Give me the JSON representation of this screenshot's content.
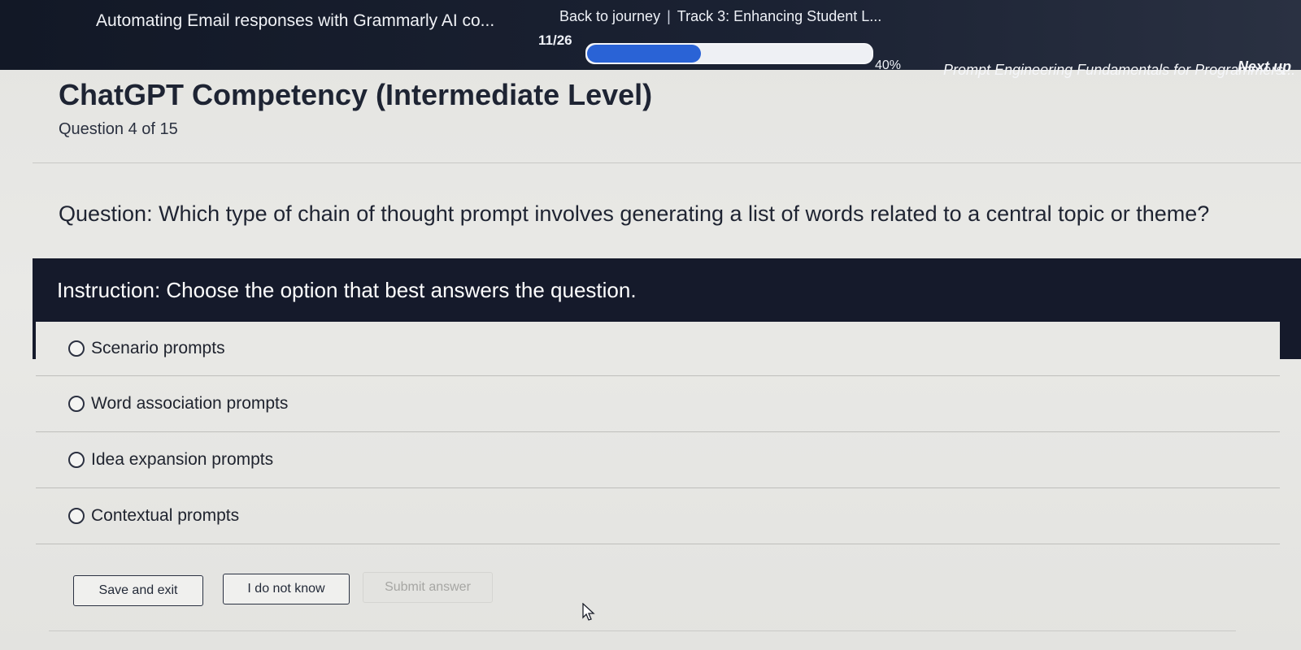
{
  "header": {
    "course_title": "Automating Email responses with Grammarly AI co...",
    "back_to_journey": "Back to journey",
    "separator": "|",
    "track_title": "Track 3: Enhancing Student L...",
    "progress_count": "11/26",
    "progress_percent_label": "40%",
    "progress_fraction": 0.4,
    "next_up_label": "Next up",
    "next_up_course": "Prompt Engineering Fundamentals for Programmers..."
  },
  "quiz": {
    "title": "ChatGPT Competency (Intermediate Level)",
    "question_count": "Question 4 of 15",
    "question": "Question: Which type of chain of thought prompt involves generating a list of words related to a central topic or theme?",
    "instruction": "Instruction: Choose the option that best answers the question.",
    "options": [
      {
        "label": "Scenario prompts"
      },
      {
        "label": "Word association prompts"
      },
      {
        "label": "Idea expansion prompts"
      },
      {
        "label": "Contextual prompts"
      }
    ]
  },
  "actions": {
    "save_label": "Save and exit",
    "idk_label": "I do not know",
    "submit_label": "Submit answer"
  },
  "colors": {
    "header_bg": "#151a2b",
    "progress_fill": "#2a63d6",
    "instruction_bg": "#151a2b"
  }
}
